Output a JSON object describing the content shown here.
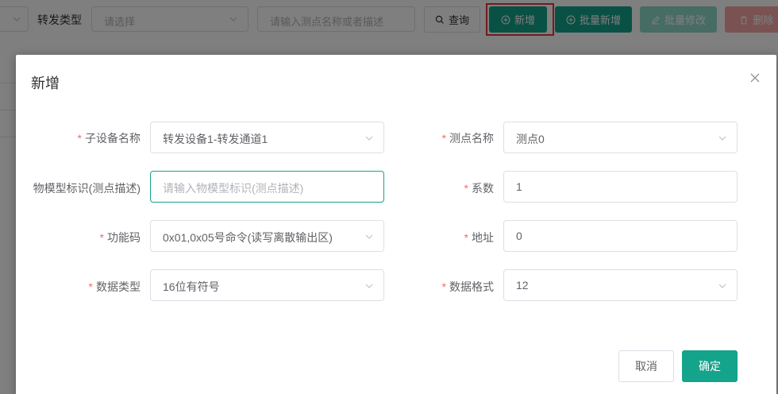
{
  "toolbar": {
    "forward_type_label": "转发类型",
    "forward_type_placeholder": "请选择",
    "search_placeholder": "请输入测点名称或者描述",
    "query_label": "查询",
    "add_label": "新增",
    "batch_add_label": "批量新增",
    "batch_edit_label": "批量修改",
    "delete_label": "删除"
  },
  "dialog": {
    "title": "新增",
    "fields": {
      "sub_device": {
        "label": "子设备名称",
        "required": true,
        "value": "转发设备1-转发通道1"
      },
      "point_name": {
        "label": "测点名称",
        "required": true,
        "value": "测点0"
      },
      "model_id": {
        "label": "物模型标识(测点描述)",
        "required": false,
        "placeholder": "请输入物模型标识(测点描述)"
      },
      "coefficient": {
        "label": "系数",
        "required": true,
        "value": "1"
      },
      "function_code": {
        "label": "功能码",
        "required": true,
        "value": "0x01,0x05号命令(读写离散输出区)"
      },
      "address": {
        "label": "地址",
        "required": true,
        "value": "0"
      },
      "data_type": {
        "label": "数据类型",
        "required": true,
        "value": "16位有符号"
      },
      "data_format": {
        "label": "数据格式",
        "required": true,
        "value": "12"
      }
    },
    "required_mark": "*",
    "cancel_label": "取消",
    "ok_label": "确定"
  },
  "colors": {
    "primary": "#14a38b",
    "danger": "#f56c6c",
    "highlight": "#e0383e"
  }
}
